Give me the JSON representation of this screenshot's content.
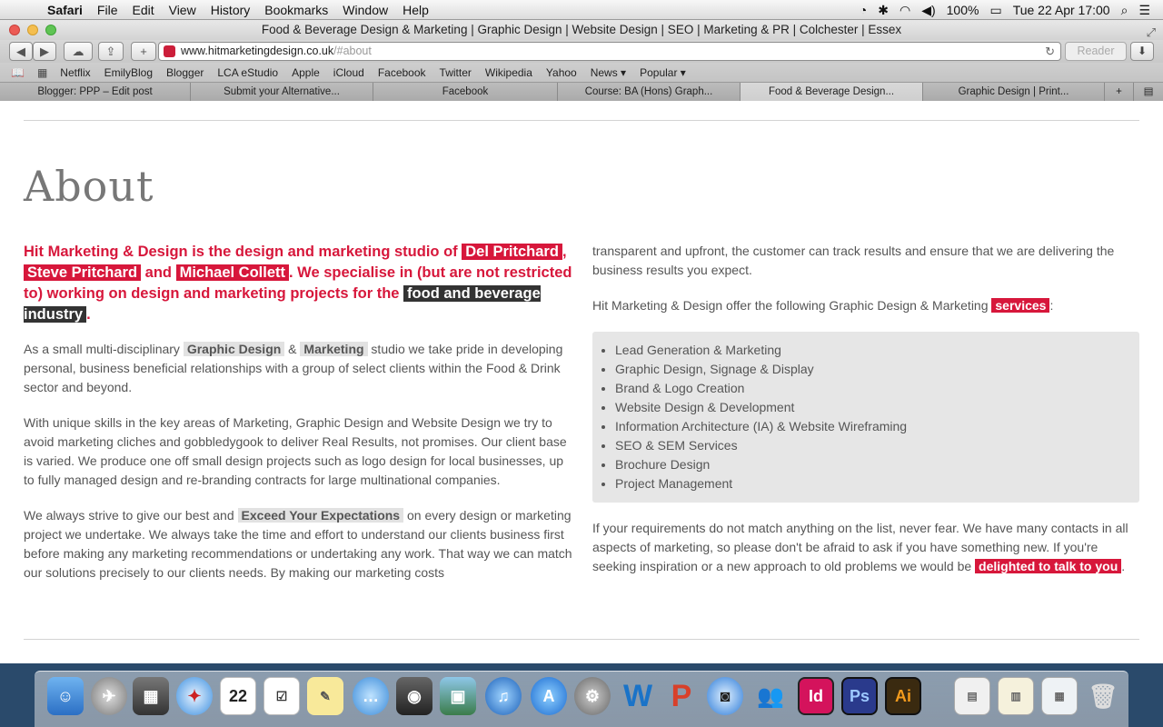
{
  "menubar": {
    "apple_icon": "apple-icon",
    "items": [
      "Safari",
      "File",
      "Edit",
      "View",
      "History",
      "Bookmarks",
      "Window",
      "Help"
    ],
    "battery": "100%",
    "datetime": "Tue 22 Apr  17:00"
  },
  "window": {
    "title": "Food & Beverage Design & Marketing | Graphic Design | Website Design | SEO | Marketing & PR | Colchester | Essex"
  },
  "toolbar": {
    "url_host": "www.hitmarketingdesign.co.uk",
    "url_hash": "/#about",
    "reader_label": "Reader"
  },
  "bookmarks": [
    "Netflix",
    "EmilyBlog",
    "Blogger",
    "LCA eStudio",
    "Apple",
    "iCloud",
    "Facebook",
    "Twitter",
    "Wikipedia",
    "Yahoo",
    "News ▾",
    "Popular ▾"
  ],
  "tabs": [
    "Blogger: PPP – Edit post",
    "Submit your Alternative...",
    "Facebook",
    "Course: BA (Hons) Graph...",
    "Food & Beverage Design...",
    "Graphic Design | Print..."
  ],
  "page": {
    "title": "About",
    "lead": {
      "t1": "Hit Marketing & Design is the design and marketing studio of ",
      "name1": "Del Pritchard",
      "sep1": ", ",
      "name2": "Steve Pritchard",
      "sep2": " and ",
      "name3": "Michael Collett",
      "t2": ". We specialise in (but are not restricted to) working on design and marketing projects for the ",
      "industry": "food and beverage industry",
      "t3": "."
    },
    "p1": {
      "t1": "As a small multi-disciplinary ",
      "tag1": "Graphic Design",
      "t2": " & ",
      "tag2": "Marketing",
      "t3": " studio we take pride in developing personal, business beneficial relationships with a group of select clients within the Food & Drink sector and beyond."
    },
    "p2": "With unique skills in the key areas of Marketing, Graphic Design and Website Design we try to avoid marketing cliches and gobbledygook to deliver Real Results, not promises. Our client base is varied. We produce one off small design projects such as logo design for local businesses, up to fully managed design and re-branding contracts for large multinational companies.",
    "p3": {
      "t1": "We always strive to give our best and ",
      "tag": "Exceed Your Expectations",
      "t2": " on every design or marketing project we undertake. We always take the time and effort to understand our clients business first before making any marketing recommendations or undertaking any work. That way we can match our solutions precisely to our clients needs. By making our marketing costs"
    },
    "p4": "transparent and upfront, the customer can track results and ensure that we are delivering the business results you expect.",
    "p5": {
      "t1": "Hit Marketing & Design offer the following Graphic Design & Marketing ",
      "tag": "services",
      "t2": ":"
    },
    "services": [
      "Lead Generation & Marketing",
      "Graphic Design, Signage & Display",
      "Brand & Logo Creation",
      "Website Design & Development",
      "Information Architecture (IA) & Website Wireframing",
      "SEO & SEM Services",
      "Brochure Design",
      "Project Management"
    ],
    "p6": {
      "t1": "If your requirements do not match anything on the list, never fear. We have many contacts in all aspects of marketing, so please don't be afraid to ask if you have something new. If you're seeking inspiration or a new approach to old problems we would be ",
      "tag": "delighted to talk to you",
      "t2": "."
    }
  },
  "dock": {
    "calendar_day": "22",
    "indesign": "Id",
    "photoshop": "Ps",
    "illustrator": "Ai",
    "colors": {
      "indesign": "#d4135c",
      "photoshop": "#2a3a8c",
      "illustrator": "#f39b1c"
    }
  }
}
